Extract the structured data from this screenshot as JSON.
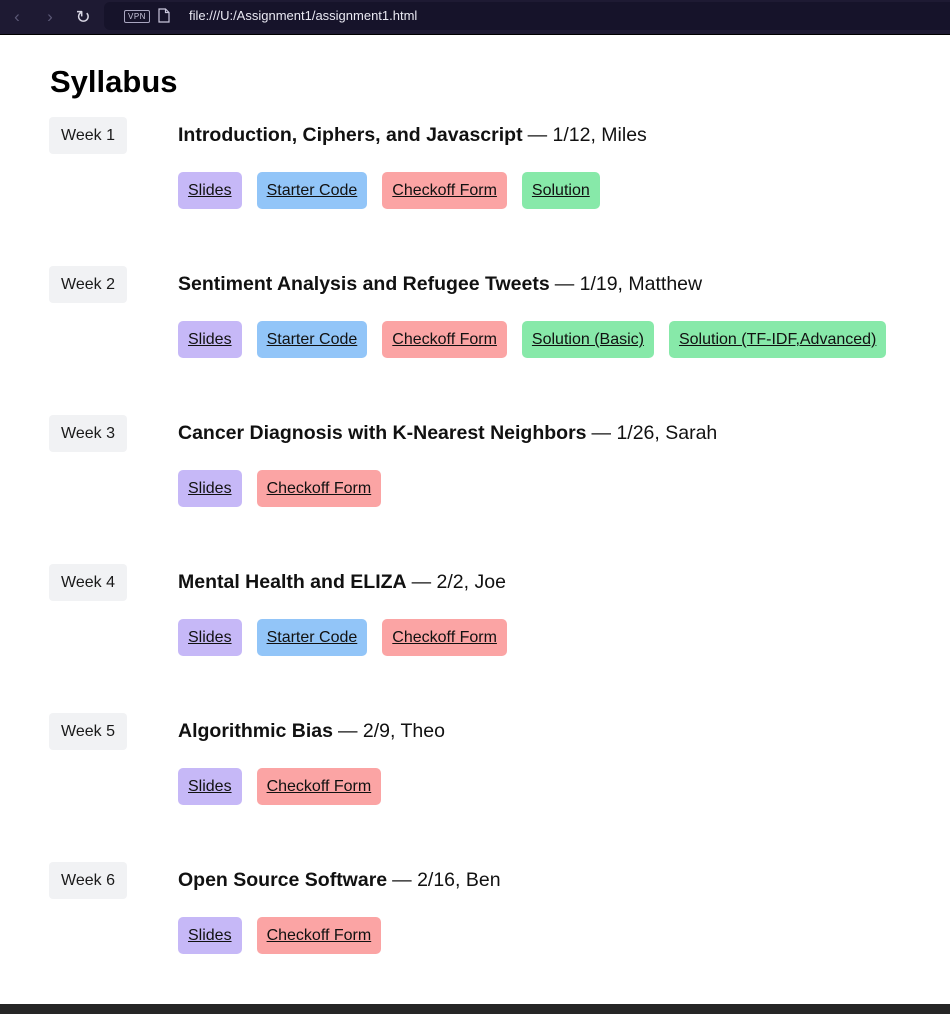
{
  "browser": {
    "back_icon": "chevron-left-icon",
    "forward_icon": "chevron-right-icon",
    "reload_icon": "reload-icon",
    "vpn_label": "VPN",
    "url": "file:///U:/Assignment1/assignment1.html"
  },
  "page": {
    "title": "Syllabus"
  },
  "colors": {
    "slides": "#c6b8f7",
    "starter": "#92c5f8",
    "checkoff": "#fba4a4",
    "solution": "#87e9a9",
    "week_badge": "#f1f2f4"
  },
  "weeks": [
    {
      "label": "Week 1",
      "topic": "Introduction, Ciphers, and Javascript",
      "sep": "—",
      "detail": "1/12, Miles",
      "links": [
        {
          "label": "Slides",
          "kind": "slides"
        },
        {
          "label": "Starter Code",
          "kind": "starter"
        },
        {
          "label": "Checkoff Form",
          "kind": "checkoff"
        },
        {
          "label": "Solution",
          "kind": "solution"
        }
      ]
    },
    {
      "label": "Week 2",
      "topic": "Sentiment Analysis and Refugee Tweets",
      "sep": "—",
      "detail": "1/19, Matthew",
      "links": [
        {
          "label": "Slides",
          "kind": "slides"
        },
        {
          "label": "Starter Code",
          "kind": "starter"
        },
        {
          "label": "Checkoff Form",
          "kind": "checkoff"
        },
        {
          "label": "Solution (Basic)",
          "kind": "solution"
        },
        {
          "label": "Solution (TF-IDF,Advanced)",
          "kind": "solution"
        }
      ]
    },
    {
      "label": "Week 3",
      "topic": "Cancer Diagnosis with K-Nearest Neighbors",
      "sep": "—",
      "detail": "1/26, Sarah",
      "links": [
        {
          "label": "Slides",
          "kind": "slides"
        },
        {
          "label": "Checkoff Form",
          "kind": "checkoff"
        }
      ]
    },
    {
      "label": "Week 4",
      "topic": "Mental Health and ELIZA",
      "sep": "—",
      "detail": "2/2, Joe",
      "links": [
        {
          "label": "Slides",
          "kind": "slides"
        },
        {
          "label": "Starter Code",
          "kind": "starter"
        },
        {
          "label": "Checkoff Form",
          "kind": "checkoff"
        }
      ]
    },
    {
      "label": "Week 5",
      "topic": "Algorithmic Bias",
      "sep": "—",
      "detail": "2/9, Theo",
      "links": [
        {
          "label": "Slides",
          "kind": "slides"
        },
        {
          "label": "Checkoff Form",
          "kind": "checkoff"
        }
      ]
    },
    {
      "label": "Week 6",
      "topic": "Open Source Software",
      "sep": "—",
      "detail": "2/16, Ben",
      "links": [
        {
          "label": "Slides",
          "kind": "slides"
        },
        {
          "label": "Checkoff Form",
          "kind": "checkoff"
        }
      ]
    }
  ]
}
